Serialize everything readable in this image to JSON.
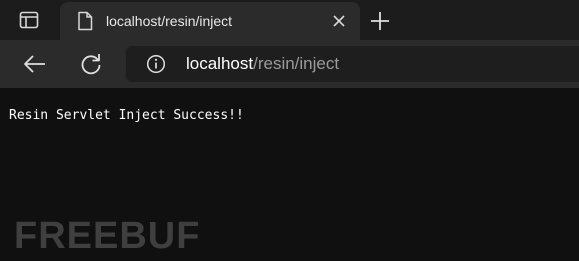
{
  "tab": {
    "title": "localhost/resin/inject"
  },
  "omnibox": {
    "host": "localhost",
    "path": "/resin/inject"
  },
  "page": {
    "body_text": "Resin Servlet Inject Success!!"
  },
  "watermark": {
    "text": "FREEBUF"
  },
  "icons": {
    "tab_actions": "tab-actions-icon",
    "favicon": "document-icon",
    "close": "close-icon",
    "new_tab": "plus-icon",
    "back": "back-arrow-icon",
    "refresh": "refresh-icon",
    "site_info": "info-icon"
  },
  "colors": {
    "tabstrip_bg": "#1c1c1c",
    "toolbar_bg": "#2b2b2b",
    "omnibox_bg": "#1e1e1e",
    "page_bg": "#101010",
    "watermark": "#3f3f3f"
  }
}
